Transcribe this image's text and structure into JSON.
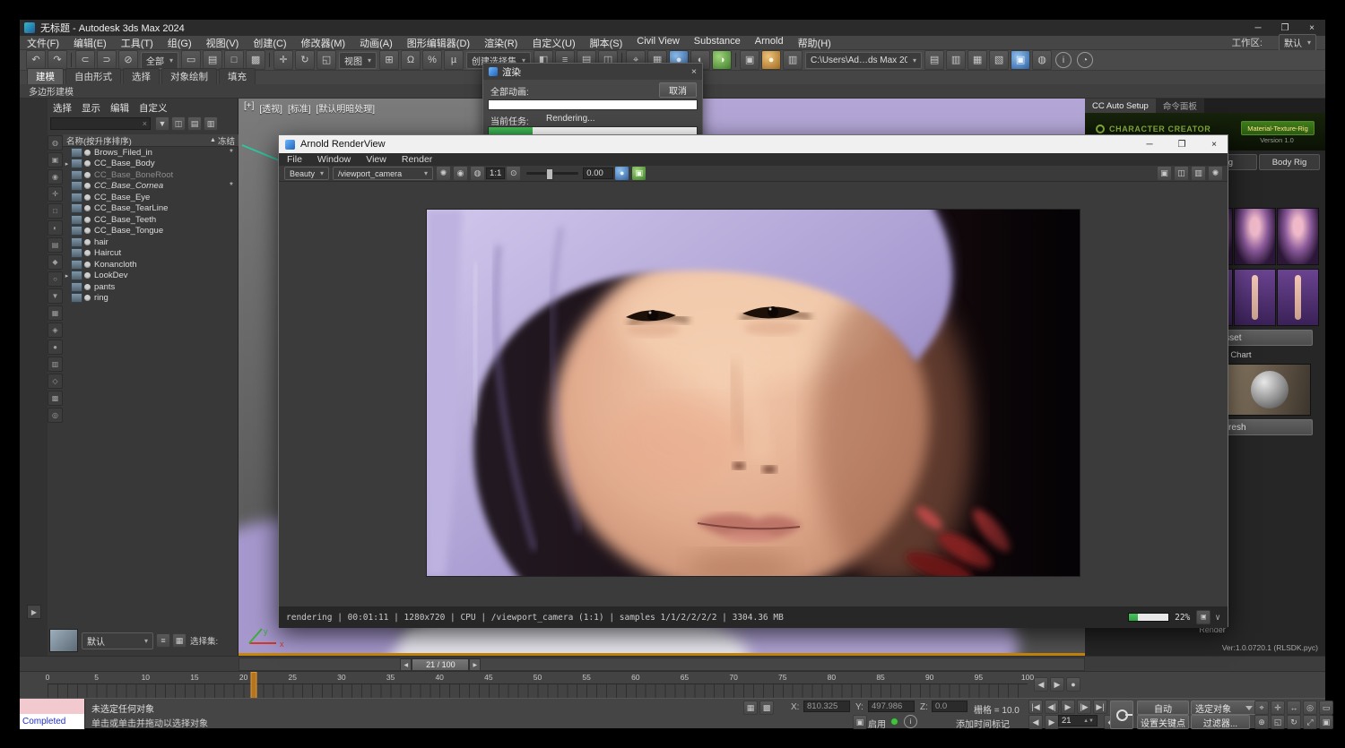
{
  "window": {
    "title": "无标题 - Autodesk 3ds Max 2024"
  },
  "menubar": {
    "items": [
      "文件(F)",
      "编辑(E)",
      "工具(T)",
      "组(G)",
      "视图(V)",
      "创建(C)",
      "修改器(M)",
      "动画(A)",
      "图形编辑器(D)",
      "渲染(R)",
      "自定义(U)",
      "脚本(S)",
      "Civil View",
      "Substance",
      "Arnold",
      "帮助(H)"
    ],
    "workspace_label": "工作区:",
    "workspace_value": "默认"
  },
  "toolbar": {
    "filter_combo": "全部",
    "coord_combo": "视图",
    "selset_combo": "创建选择集",
    "project_path": "C:\\Users\\Ad…ds Max 202…"
  },
  "ribbon": {
    "tabs": [
      "建模",
      "自由形式",
      "选择",
      "对象绘制",
      "填充"
    ],
    "active_index": 0,
    "panel_title": "多边形建模"
  },
  "explorer": {
    "menus": [
      "选择",
      "显示",
      "编辑",
      "自定义"
    ],
    "name_header": "名称(按升序排序)",
    "sort_glyph": "▲",
    "frozen_header": "冻结",
    "rows": [
      {
        "name": "Brows_Filed_in",
        "frozen": true
      },
      {
        "name": "CC_Base_Body",
        "expand": true
      },
      {
        "name": "CC_Base_BoneRoot",
        "dim": true
      },
      {
        "name": "CC_Base_Cornea",
        "italic": true,
        "frozen": true
      },
      {
        "name": "CC_Base_Eye"
      },
      {
        "name": "CC_Base_TearLine"
      },
      {
        "name": "CC_Base_Teeth"
      },
      {
        "name": "CC_Base_Tongue"
      },
      {
        "name": "hair"
      },
      {
        "name": "Haircut"
      },
      {
        "name": "Konancloth"
      },
      {
        "name": "LookDev",
        "expand": true
      },
      {
        "name": "pants"
      },
      {
        "name": "ring"
      }
    ],
    "preset_combo": "默认",
    "selection_set_label": "选择集:"
  },
  "viewport": {
    "labels": [
      "[+]",
      "[透视]",
      "[标准]",
      "[默认明暗处理]"
    ],
    "axis_x": "x",
    "axis_y": "y"
  },
  "render_dialog": {
    "title": "渲染",
    "all_anim_label": "全部动画:",
    "cancel_label": "取消",
    "task_label": "当前任务:",
    "task_value": "Rendering...",
    "anim_progress_pct": 0,
    "task_progress_pct": 21
  },
  "arnold": {
    "title": "Arnold RenderView",
    "menus": [
      "File",
      "Window",
      "View",
      "Render"
    ],
    "aov_combo": "Beauty",
    "camera_combo": "/viewport_camera",
    "zoom_label": "1:1",
    "exposure_value": "0.00",
    "status_text": "rendering | 00:01:11 | 1280x720 | CPU | /viewport_camera (1:1) | samples 1/1/2/2/2/2 | 3304.36 MB",
    "progress_pct": 22,
    "progress_label": "22%"
  },
  "cc_panel": {
    "tab_auto_setup": "CC Auto Setup",
    "tab_command": "命令面板",
    "brand": "CHARACTER CREATOR",
    "mtr_button": "Material-Texture-Rig",
    "version": "Version 1.0",
    "face_rig_tab": "Face Rig",
    "body_rig_tab": "Body Rig",
    "asset_button": "Asset",
    "chart_label": "Teeth Chart",
    "refresh_button": "Refresh",
    "render_label": "Render",
    "version_footer": "Ver:1.0.0720.1 (RLSDK.pyc)"
  },
  "timeline": {
    "slider_label": "21 / 100",
    "frame": 21,
    "max": 100,
    "ticks": [
      "0",
      "5",
      "10",
      "15",
      "20",
      "25",
      "30",
      "35",
      "40",
      "45",
      "50",
      "55",
      "60",
      "65",
      "70",
      "75",
      "80",
      "85",
      "90",
      "95",
      "100"
    ]
  },
  "statusbar": {
    "listener_line2": "Completed",
    "prompt_line1": "未选定任何对象",
    "prompt_line2": "单击或单击并拖动以选择对象",
    "x_label": "X:",
    "x_value": "810.325",
    "y_label": "Y:",
    "y_value": "497.986",
    "z_label": "Z:",
    "z_value": "0.0",
    "grid_label": "栅格 = 10.0",
    "enable_label": "启用",
    "time_tag_label": "添加时间标记",
    "frame_field": "21",
    "auto_button": "自动",
    "selected_combo": "选定对象",
    "set_key_button": "设置关键点",
    "filters_button": "过滤器..."
  }
}
